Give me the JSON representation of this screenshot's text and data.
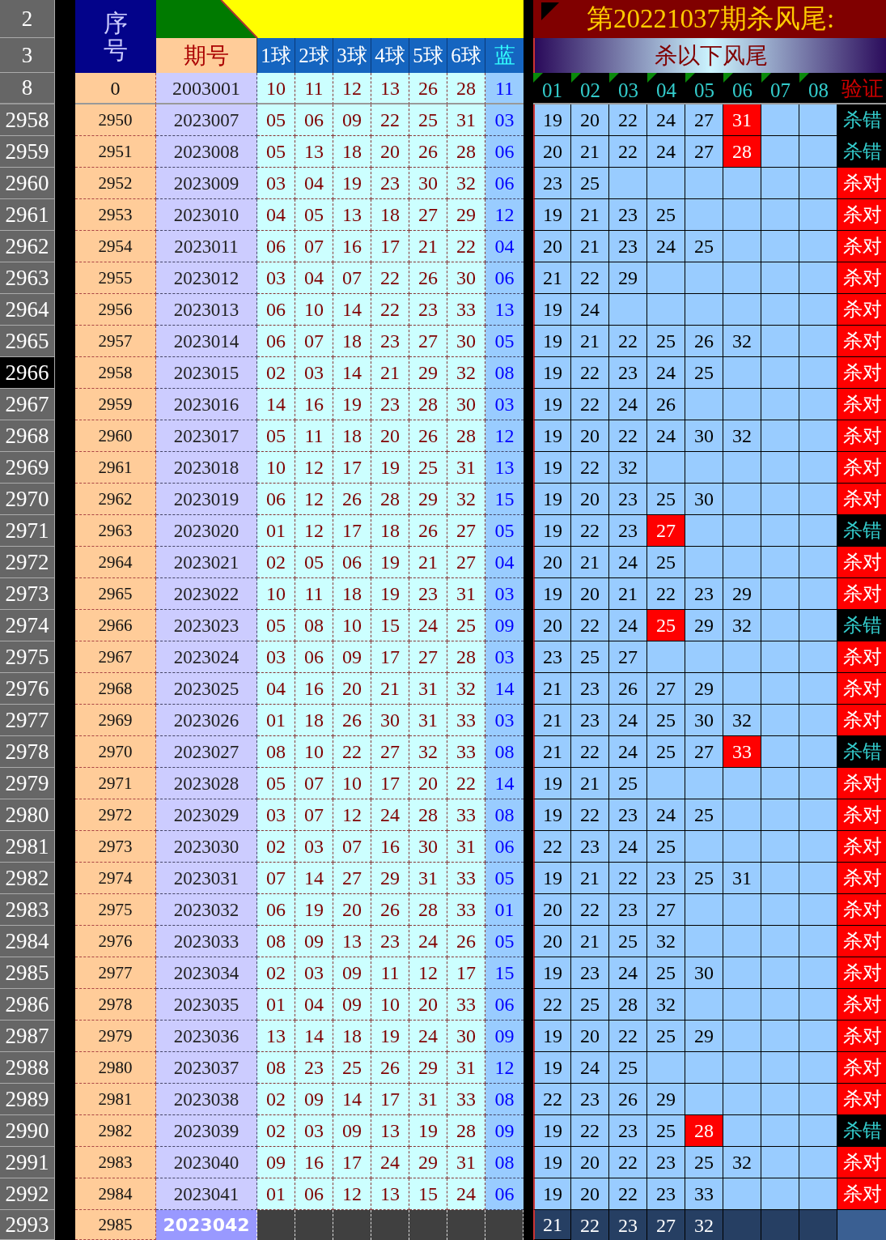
{
  "header": {
    "row_numbers": [
      "2",
      "3"
    ],
    "seq_label": "序号",
    "period_label": "期号",
    "ball_labels": [
      "1球",
      "2球",
      "3球",
      "4球",
      "5球",
      "6球"
    ],
    "blue_label": "蓝",
    "title": "第20221037期杀风尾:",
    "subtitle": "杀以下风尾",
    "kill_columns": [
      "01",
      "02",
      "03",
      "04",
      "05",
      "06",
      "07",
      "08"
    ],
    "verdict_label": "验证"
  },
  "baseline": {
    "row_number": "8",
    "seq": "0",
    "period": "2003001",
    "balls": [
      "10",
      "11",
      "12",
      "13",
      "26",
      "28"
    ],
    "blue": "11"
  },
  "rows": [
    {
      "row_number": "2958",
      "selected": false,
      "kind": "past",
      "seq": "2950",
      "period": "2023007",
      "balls": [
        "05",
        "06",
        "09",
        "22",
        "25",
        "31"
      ],
      "blue": "03",
      "kills": [
        {
          "n": "19",
          "hit": false
        },
        {
          "n": "20",
          "hit": false
        },
        {
          "n": "22",
          "hit": false
        },
        {
          "n": "24",
          "hit": false
        },
        {
          "n": "27",
          "hit": false
        },
        {
          "n": "31",
          "hit": true
        }
      ],
      "verdict": {
        "text": "杀错",
        "correct": false
      }
    },
    {
      "row_number": "2959",
      "selected": false,
      "kind": "past",
      "seq": "2951",
      "period": "2023008",
      "balls": [
        "05",
        "13",
        "18",
        "20",
        "26",
        "28"
      ],
      "blue": "06",
      "kills": [
        {
          "n": "20",
          "hit": false
        },
        {
          "n": "21",
          "hit": false
        },
        {
          "n": "22",
          "hit": false
        },
        {
          "n": "24",
          "hit": false
        },
        {
          "n": "27",
          "hit": false
        },
        {
          "n": "28",
          "hit": true
        }
      ],
      "verdict": {
        "text": "杀错",
        "correct": false
      }
    },
    {
      "row_number": "2960",
      "selected": false,
      "kind": "past",
      "seq": "2952",
      "period": "2023009",
      "balls": [
        "03",
        "04",
        "19",
        "23",
        "30",
        "32"
      ],
      "blue": "06",
      "kills": [
        {
          "n": "23",
          "hit": false
        },
        {
          "n": "25",
          "hit": false
        }
      ],
      "verdict": {
        "text": "杀对",
        "correct": true
      }
    },
    {
      "row_number": "2961",
      "selected": false,
      "kind": "past",
      "seq": "2953",
      "period": "2023010",
      "balls": [
        "04",
        "05",
        "13",
        "18",
        "27",
        "29"
      ],
      "blue": "12",
      "kills": [
        {
          "n": "19",
          "hit": false
        },
        {
          "n": "21",
          "hit": false
        },
        {
          "n": "23",
          "hit": false
        },
        {
          "n": "25",
          "hit": false
        }
      ],
      "verdict": {
        "text": "杀对",
        "correct": true
      }
    },
    {
      "row_number": "2962",
      "selected": false,
      "kind": "past",
      "seq": "2954",
      "period": "2023011",
      "balls": [
        "06",
        "07",
        "16",
        "17",
        "21",
        "22"
      ],
      "blue": "04",
      "kills": [
        {
          "n": "20",
          "hit": false
        },
        {
          "n": "21",
          "hit": false
        },
        {
          "n": "23",
          "hit": false
        },
        {
          "n": "24",
          "hit": false
        },
        {
          "n": "25",
          "hit": false
        }
      ],
      "verdict": {
        "text": "杀对",
        "correct": true
      }
    },
    {
      "row_number": "2963",
      "selected": false,
      "kind": "past",
      "seq": "2955",
      "period": "2023012",
      "balls": [
        "03",
        "04",
        "07",
        "22",
        "26",
        "30"
      ],
      "blue": "06",
      "kills": [
        {
          "n": "21",
          "hit": false
        },
        {
          "n": "22",
          "hit": false
        },
        {
          "n": "29",
          "hit": false
        }
      ],
      "verdict": {
        "text": "杀对",
        "correct": true
      }
    },
    {
      "row_number": "2964",
      "selected": false,
      "kind": "past",
      "seq": "2956",
      "period": "2023013",
      "balls": [
        "06",
        "10",
        "14",
        "22",
        "23",
        "33"
      ],
      "blue": "13",
      "kills": [
        {
          "n": "19",
          "hit": false
        },
        {
          "n": "24",
          "hit": false
        }
      ],
      "verdict": {
        "text": "杀对",
        "correct": true
      }
    },
    {
      "row_number": "2965",
      "selected": false,
      "kind": "past",
      "seq": "2957",
      "period": "2023014",
      "balls": [
        "06",
        "07",
        "18",
        "23",
        "27",
        "30"
      ],
      "blue": "05",
      "kills": [
        {
          "n": "19",
          "hit": false
        },
        {
          "n": "21",
          "hit": false
        },
        {
          "n": "22",
          "hit": false
        },
        {
          "n": "25",
          "hit": false
        },
        {
          "n": "26",
          "hit": false
        },
        {
          "n": "32",
          "hit": false
        }
      ],
      "verdict": {
        "text": "杀对",
        "correct": true
      }
    },
    {
      "row_number": "2966",
      "selected": true,
      "kind": "past",
      "seq": "2958",
      "period": "2023015",
      "balls": [
        "02",
        "03",
        "14",
        "21",
        "29",
        "32"
      ],
      "blue": "08",
      "kills": [
        {
          "n": "19",
          "hit": false
        },
        {
          "n": "22",
          "hit": false
        },
        {
          "n": "23",
          "hit": false
        },
        {
          "n": "24",
          "hit": false
        },
        {
          "n": "25",
          "hit": false
        }
      ],
      "verdict": {
        "text": "杀对",
        "correct": true
      }
    },
    {
      "row_number": "2967",
      "selected": false,
      "kind": "past",
      "seq": "2959",
      "period": "2023016",
      "balls": [
        "14",
        "16",
        "19",
        "23",
        "28",
        "30"
      ],
      "blue": "03",
      "kills": [
        {
          "n": "19",
          "hit": false
        },
        {
          "n": "22",
          "hit": false
        },
        {
          "n": "24",
          "hit": false
        },
        {
          "n": "26",
          "hit": false
        }
      ],
      "verdict": {
        "text": "杀对",
        "correct": true
      }
    },
    {
      "row_number": "2968",
      "selected": false,
      "kind": "past",
      "seq": "2960",
      "period": "2023017",
      "balls": [
        "05",
        "11",
        "18",
        "20",
        "26",
        "28"
      ],
      "blue": "12",
      "kills": [
        {
          "n": "19",
          "hit": false
        },
        {
          "n": "20",
          "hit": false
        },
        {
          "n": "22",
          "hit": false
        },
        {
          "n": "24",
          "hit": false
        },
        {
          "n": "30",
          "hit": false
        },
        {
          "n": "32",
          "hit": false
        }
      ],
      "verdict": {
        "text": "杀对",
        "correct": true
      }
    },
    {
      "row_number": "2969",
      "selected": false,
      "kind": "past",
      "seq": "2961",
      "period": "2023018",
      "balls": [
        "10",
        "12",
        "17",
        "19",
        "25",
        "31"
      ],
      "blue": "13",
      "kills": [
        {
          "n": "19",
          "hit": false
        },
        {
          "n": "22",
          "hit": false
        },
        {
          "n": "32",
          "hit": false
        }
      ],
      "verdict": {
        "text": "杀对",
        "correct": true
      }
    },
    {
      "row_number": "2970",
      "selected": false,
      "kind": "past",
      "seq": "2962",
      "period": "2023019",
      "balls": [
        "06",
        "12",
        "26",
        "28",
        "29",
        "32"
      ],
      "blue": "15",
      "kills": [
        {
          "n": "19",
          "hit": false
        },
        {
          "n": "20",
          "hit": false
        },
        {
          "n": "23",
          "hit": false
        },
        {
          "n": "25",
          "hit": false
        },
        {
          "n": "30",
          "hit": false
        }
      ],
      "verdict": {
        "text": "杀对",
        "correct": true
      }
    },
    {
      "row_number": "2971",
      "selected": false,
      "kind": "past",
      "seq": "2963",
      "period": "2023020",
      "balls": [
        "01",
        "12",
        "17",
        "18",
        "26",
        "27"
      ],
      "blue": "05",
      "kills": [
        {
          "n": "19",
          "hit": false
        },
        {
          "n": "22",
          "hit": false
        },
        {
          "n": "23",
          "hit": false
        },
        {
          "n": "27",
          "hit": true
        }
      ],
      "verdict": {
        "text": "杀错",
        "correct": false
      }
    },
    {
      "row_number": "2972",
      "selected": false,
      "kind": "past",
      "seq": "2964",
      "period": "2023021",
      "balls": [
        "02",
        "05",
        "06",
        "19",
        "21",
        "27"
      ],
      "blue": "04",
      "kills": [
        {
          "n": "20",
          "hit": false
        },
        {
          "n": "21",
          "hit": false
        },
        {
          "n": "24",
          "hit": false
        },
        {
          "n": "25",
          "hit": false
        }
      ],
      "verdict": {
        "text": "杀对",
        "correct": true
      }
    },
    {
      "row_number": "2973",
      "selected": false,
      "kind": "past",
      "seq": "2965",
      "period": "2023022",
      "balls": [
        "10",
        "11",
        "18",
        "19",
        "23",
        "31"
      ],
      "blue": "03",
      "kills": [
        {
          "n": "19",
          "hit": false
        },
        {
          "n": "20",
          "hit": false
        },
        {
          "n": "21",
          "hit": false
        },
        {
          "n": "22",
          "hit": false
        },
        {
          "n": "23",
          "hit": false
        },
        {
          "n": "29",
          "hit": false
        }
      ],
      "verdict": {
        "text": "杀对",
        "correct": true
      }
    },
    {
      "row_number": "2974",
      "selected": false,
      "kind": "past",
      "seq": "2966",
      "period": "2023023",
      "balls": [
        "05",
        "08",
        "10",
        "15",
        "24",
        "25"
      ],
      "blue": "09",
      "kills": [
        {
          "n": "20",
          "hit": false
        },
        {
          "n": "22",
          "hit": false
        },
        {
          "n": "24",
          "hit": false
        },
        {
          "n": "25",
          "hit": true
        },
        {
          "n": "29",
          "hit": false
        },
        {
          "n": "32",
          "hit": false
        }
      ],
      "verdict": {
        "text": "杀错",
        "correct": false
      }
    },
    {
      "row_number": "2975",
      "selected": false,
      "kind": "past",
      "seq": "2967",
      "period": "2023024",
      "balls": [
        "03",
        "06",
        "09",
        "17",
        "27",
        "28"
      ],
      "blue": "03",
      "kills": [
        {
          "n": "23",
          "hit": false
        },
        {
          "n": "25",
          "hit": false
        },
        {
          "n": "27",
          "hit": false
        }
      ],
      "verdict": {
        "text": "杀对",
        "correct": true
      }
    },
    {
      "row_number": "2976",
      "selected": false,
      "kind": "past",
      "seq": "2968",
      "period": "2023025",
      "balls": [
        "04",
        "16",
        "20",
        "21",
        "31",
        "32"
      ],
      "blue": "14",
      "kills": [
        {
          "n": "21",
          "hit": false
        },
        {
          "n": "23",
          "hit": false
        },
        {
          "n": "26",
          "hit": false
        },
        {
          "n": "27",
          "hit": false
        },
        {
          "n": "29",
          "hit": false
        }
      ],
      "verdict": {
        "text": "杀对",
        "correct": true
      }
    },
    {
      "row_number": "2977",
      "selected": false,
      "kind": "past",
      "seq": "2969",
      "period": "2023026",
      "balls": [
        "01",
        "18",
        "26",
        "30",
        "31",
        "33"
      ],
      "blue": "03",
      "kills": [
        {
          "n": "21",
          "hit": false
        },
        {
          "n": "23",
          "hit": false
        },
        {
          "n": "24",
          "hit": false
        },
        {
          "n": "25",
          "hit": false
        },
        {
          "n": "30",
          "hit": false
        },
        {
          "n": "32",
          "hit": false
        }
      ],
      "verdict": {
        "text": "杀对",
        "correct": true
      }
    },
    {
      "row_number": "2978",
      "selected": false,
      "kind": "past",
      "seq": "2970",
      "period": "2023027",
      "balls": [
        "08",
        "10",
        "22",
        "27",
        "32",
        "33"
      ],
      "blue": "08",
      "kills": [
        {
          "n": "21",
          "hit": false
        },
        {
          "n": "22",
          "hit": false
        },
        {
          "n": "24",
          "hit": false
        },
        {
          "n": "25",
          "hit": false
        },
        {
          "n": "27",
          "hit": false
        },
        {
          "n": "33",
          "hit": true
        }
      ],
      "verdict": {
        "text": "杀错",
        "correct": false
      }
    },
    {
      "row_number": "2979",
      "selected": false,
      "kind": "past",
      "seq": "2971",
      "period": "2023028",
      "balls": [
        "05",
        "07",
        "10",
        "17",
        "20",
        "22"
      ],
      "blue": "14",
      "kills": [
        {
          "n": "19",
          "hit": false
        },
        {
          "n": "21",
          "hit": false
        },
        {
          "n": "25",
          "hit": false
        }
      ],
      "verdict": {
        "text": "杀对",
        "correct": true
      }
    },
    {
      "row_number": "2980",
      "selected": false,
      "kind": "past",
      "seq": "2972",
      "period": "2023029",
      "balls": [
        "03",
        "07",
        "12",
        "24",
        "28",
        "33"
      ],
      "blue": "08",
      "kills": [
        {
          "n": "19",
          "hit": false
        },
        {
          "n": "22",
          "hit": false
        },
        {
          "n": "23",
          "hit": false
        },
        {
          "n": "24",
          "hit": false
        },
        {
          "n": "25",
          "hit": false
        }
      ],
      "verdict": {
        "text": "杀对",
        "correct": true
      }
    },
    {
      "row_number": "2981",
      "selected": false,
      "kind": "past",
      "seq": "2973",
      "period": "2023030",
      "balls": [
        "02",
        "03",
        "07",
        "16",
        "30",
        "31"
      ],
      "blue": "06",
      "kills": [
        {
          "n": "22",
          "hit": false
        },
        {
          "n": "23",
          "hit": false
        },
        {
          "n": "24",
          "hit": false
        },
        {
          "n": "25",
          "hit": false
        }
      ],
      "verdict": {
        "text": "杀对",
        "correct": true
      }
    },
    {
      "row_number": "2982",
      "selected": false,
      "kind": "past",
      "seq": "2974",
      "period": "2023031",
      "balls": [
        "07",
        "14",
        "27",
        "29",
        "31",
        "33"
      ],
      "blue": "05",
      "kills": [
        {
          "n": "19",
          "hit": false
        },
        {
          "n": "21",
          "hit": false
        },
        {
          "n": "22",
          "hit": false
        },
        {
          "n": "23",
          "hit": false
        },
        {
          "n": "25",
          "hit": false
        },
        {
          "n": "31",
          "hit": false
        }
      ],
      "verdict": {
        "text": "杀对",
        "correct": true
      }
    },
    {
      "row_number": "2983",
      "selected": false,
      "kind": "past",
      "seq": "2975",
      "period": "2023032",
      "balls": [
        "06",
        "19",
        "20",
        "26",
        "28",
        "33"
      ],
      "blue": "01",
      "kills": [
        {
          "n": "20",
          "hit": false
        },
        {
          "n": "22",
          "hit": false
        },
        {
          "n": "23",
          "hit": false
        },
        {
          "n": "27",
          "hit": false
        }
      ],
      "verdict": {
        "text": "杀对",
        "correct": true
      }
    },
    {
      "row_number": "2984",
      "selected": false,
      "kind": "past",
      "seq": "2976",
      "period": "2023033",
      "balls": [
        "08",
        "09",
        "13",
        "23",
        "24",
        "26"
      ],
      "blue": "05",
      "kills": [
        {
          "n": "20",
          "hit": false
        },
        {
          "n": "21",
          "hit": false
        },
        {
          "n": "25",
          "hit": false
        },
        {
          "n": "32",
          "hit": false
        }
      ],
      "verdict": {
        "text": "杀对",
        "correct": true
      }
    },
    {
      "row_number": "2985",
      "selected": false,
      "kind": "past",
      "seq": "2977",
      "period": "2023034",
      "balls": [
        "02",
        "03",
        "09",
        "11",
        "12",
        "17"
      ],
      "blue": "15",
      "kills": [
        {
          "n": "19",
          "hit": false
        },
        {
          "n": "23",
          "hit": false
        },
        {
          "n": "24",
          "hit": false
        },
        {
          "n": "25",
          "hit": false
        },
        {
          "n": "30",
          "hit": false
        }
      ],
      "verdict": {
        "text": "杀对",
        "correct": true
      }
    },
    {
      "row_number": "2986",
      "selected": false,
      "kind": "past",
      "seq": "2978",
      "period": "2023035",
      "balls": [
        "01",
        "04",
        "09",
        "10",
        "20",
        "33"
      ],
      "blue": "06",
      "kills": [
        {
          "n": "22",
          "hit": false
        },
        {
          "n": "25",
          "hit": false
        },
        {
          "n": "28",
          "hit": false
        },
        {
          "n": "32",
          "hit": false
        }
      ],
      "verdict": {
        "text": "杀对",
        "correct": true
      }
    },
    {
      "row_number": "2987",
      "selected": false,
      "kind": "past",
      "seq": "2979",
      "period": "2023036",
      "balls": [
        "13",
        "14",
        "18",
        "19",
        "24",
        "30"
      ],
      "blue": "09",
      "kills": [
        {
          "n": "19",
          "hit": false
        },
        {
          "n": "20",
          "hit": false
        },
        {
          "n": "22",
          "hit": false
        },
        {
          "n": "25",
          "hit": false
        },
        {
          "n": "29",
          "hit": false
        }
      ],
      "verdict": {
        "text": "杀对",
        "correct": true
      }
    },
    {
      "row_number": "2988",
      "selected": false,
      "kind": "past",
      "seq": "2980",
      "period": "2023037",
      "balls": [
        "08",
        "23",
        "25",
        "26",
        "29",
        "31"
      ],
      "blue": "12",
      "kills": [
        {
          "n": "19",
          "hit": false
        },
        {
          "n": "24",
          "hit": false
        },
        {
          "n": "25",
          "hit": false
        }
      ],
      "verdict": {
        "text": "杀对",
        "correct": true
      }
    },
    {
      "row_number": "2989",
      "selected": false,
      "kind": "past",
      "seq": "2981",
      "period": "2023038",
      "balls": [
        "02",
        "09",
        "14",
        "17",
        "31",
        "33"
      ],
      "blue": "08",
      "kills": [
        {
          "n": "22",
          "hit": false
        },
        {
          "n": "23",
          "hit": false
        },
        {
          "n": "26",
          "hit": false
        },
        {
          "n": "29",
          "hit": false
        }
      ],
      "verdict": {
        "text": "杀对",
        "correct": true
      }
    },
    {
      "row_number": "2990",
      "selected": false,
      "kind": "past",
      "seq": "2982",
      "period": "2023039",
      "balls": [
        "02",
        "03",
        "09",
        "13",
        "19",
        "28"
      ],
      "blue": "09",
      "kills": [
        {
          "n": "19",
          "hit": false
        },
        {
          "n": "22",
          "hit": false
        },
        {
          "n": "23",
          "hit": false
        },
        {
          "n": "25",
          "hit": false
        },
        {
          "n": "28",
          "hit": true
        }
      ],
      "verdict": {
        "text": "杀错",
        "correct": false
      }
    },
    {
      "row_number": "2991",
      "selected": false,
      "kind": "past",
      "seq": "2983",
      "period": "2023040",
      "balls": [
        "09",
        "16",
        "17",
        "24",
        "29",
        "31"
      ],
      "blue": "08",
      "kills": [
        {
          "n": "19",
          "hit": false
        },
        {
          "n": "20",
          "hit": false
        },
        {
          "n": "22",
          "hit": false
        },
        {
          "n": "23",
          "hit": false
        },
        {
          "n": "25",
          "hit": false
        },
        {
          "n": "32",
          "hit": false
        }
      ],
      "verdict": {
        "text": "杀对",
        "correct": true
      }
    },
    {
      "row_number": "2992",
      "selected": false,
      "kind": "past",
      "seq": "2984",
      "period": "2023041",
      "balls": [
        "01",
        "06",
        "12",
        "13",
        "15",
        "24"
      ],
      "blue": "06",
      "kills": [
        {
          "n": "19",
          "hit": false
        },
        {
          "n": "20",
          "hit": false
        },
        {
          "n": "22",
          "hit": false
        },
        {
          "n": "23",
          "hit": false
        },
        {
          "n": "33",
          "hit": false
        }
      ],
      "verdict": {
        "text": "杀对",
        "correct": true
      }
    },
    {
      "row_number": "2993",
      "selected": false,
      "kind": "current",
      "seq": "2985",
      "period": "2023042",
      "kills": [
        {
          "n": "21",
          "hit": false
        },
        {
          "n": "22",
          "hit": false
        },
        {
          "n": "23",
          "hit": false
        },
        {
          "n": "27",
          "hit": false
        },
        {
          "n": "32",
          "hit": false
        }
      ]
    }
  ]
}
